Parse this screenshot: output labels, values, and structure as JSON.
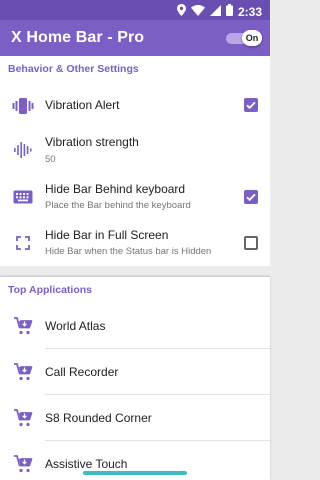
{
  "status_bar": {
    "time": "2:33",
    "icons": [
      "location-icon",
      "wifi-icon",
      "signal-icon",
      "battery-icon"
    ]
  },
  "app_bar": {
    "title": "X Home Bar - Pro",
    "toggle_label": "On",
    "toggle_state": true
  },
  "settings": {
    "header": "Behavior & Other Settings",
    "items": [
      {
        "icon": "vibration-icon",
        "title": "Vibration Alert",
        "subtitle": "",
        "checked": true
      },
      {
        "icon": "sound-wave-icon",
        "title": "Vibration strength",
        "subtitle": "50"
      },
      {
        "icon": "keyboard-icon",
        "title": "Hide Bar Behind keyboard",
        "subtitle": "Place the Bar behind the keyboard",
        "checked": true
      },
      {
        "icon": "fullscreen-icon",
        "title": "Hide Bar in Full Screen",
        "subtitle": "Hide Bar when the Status bar is Hidden",
        "checked": false
      }
    ]
  },
  "apps": {
    "header": "Top Applications",
    "items": [
      {
        "icon": "shopping-cart-download-icon",
        "title": "World Atlas"
      },
      {
        "icon": "shopping-cart-download-icon",
        "title": "Call Recorder"
      },
      {
        "icon": "shopping-cart-download-icon",
        "title": "S8 Rounded Corner"
      },
      {
        "icon": "shopping-cart-download-icon",
        "title": "Assistive Touch"
      }
    ]
  },
  "colors": {
    "accent": "#7b5fc4",
    "status_bar": "#6a4fb2",
    "home_indicator": "#3dbcc7"
  }
}
